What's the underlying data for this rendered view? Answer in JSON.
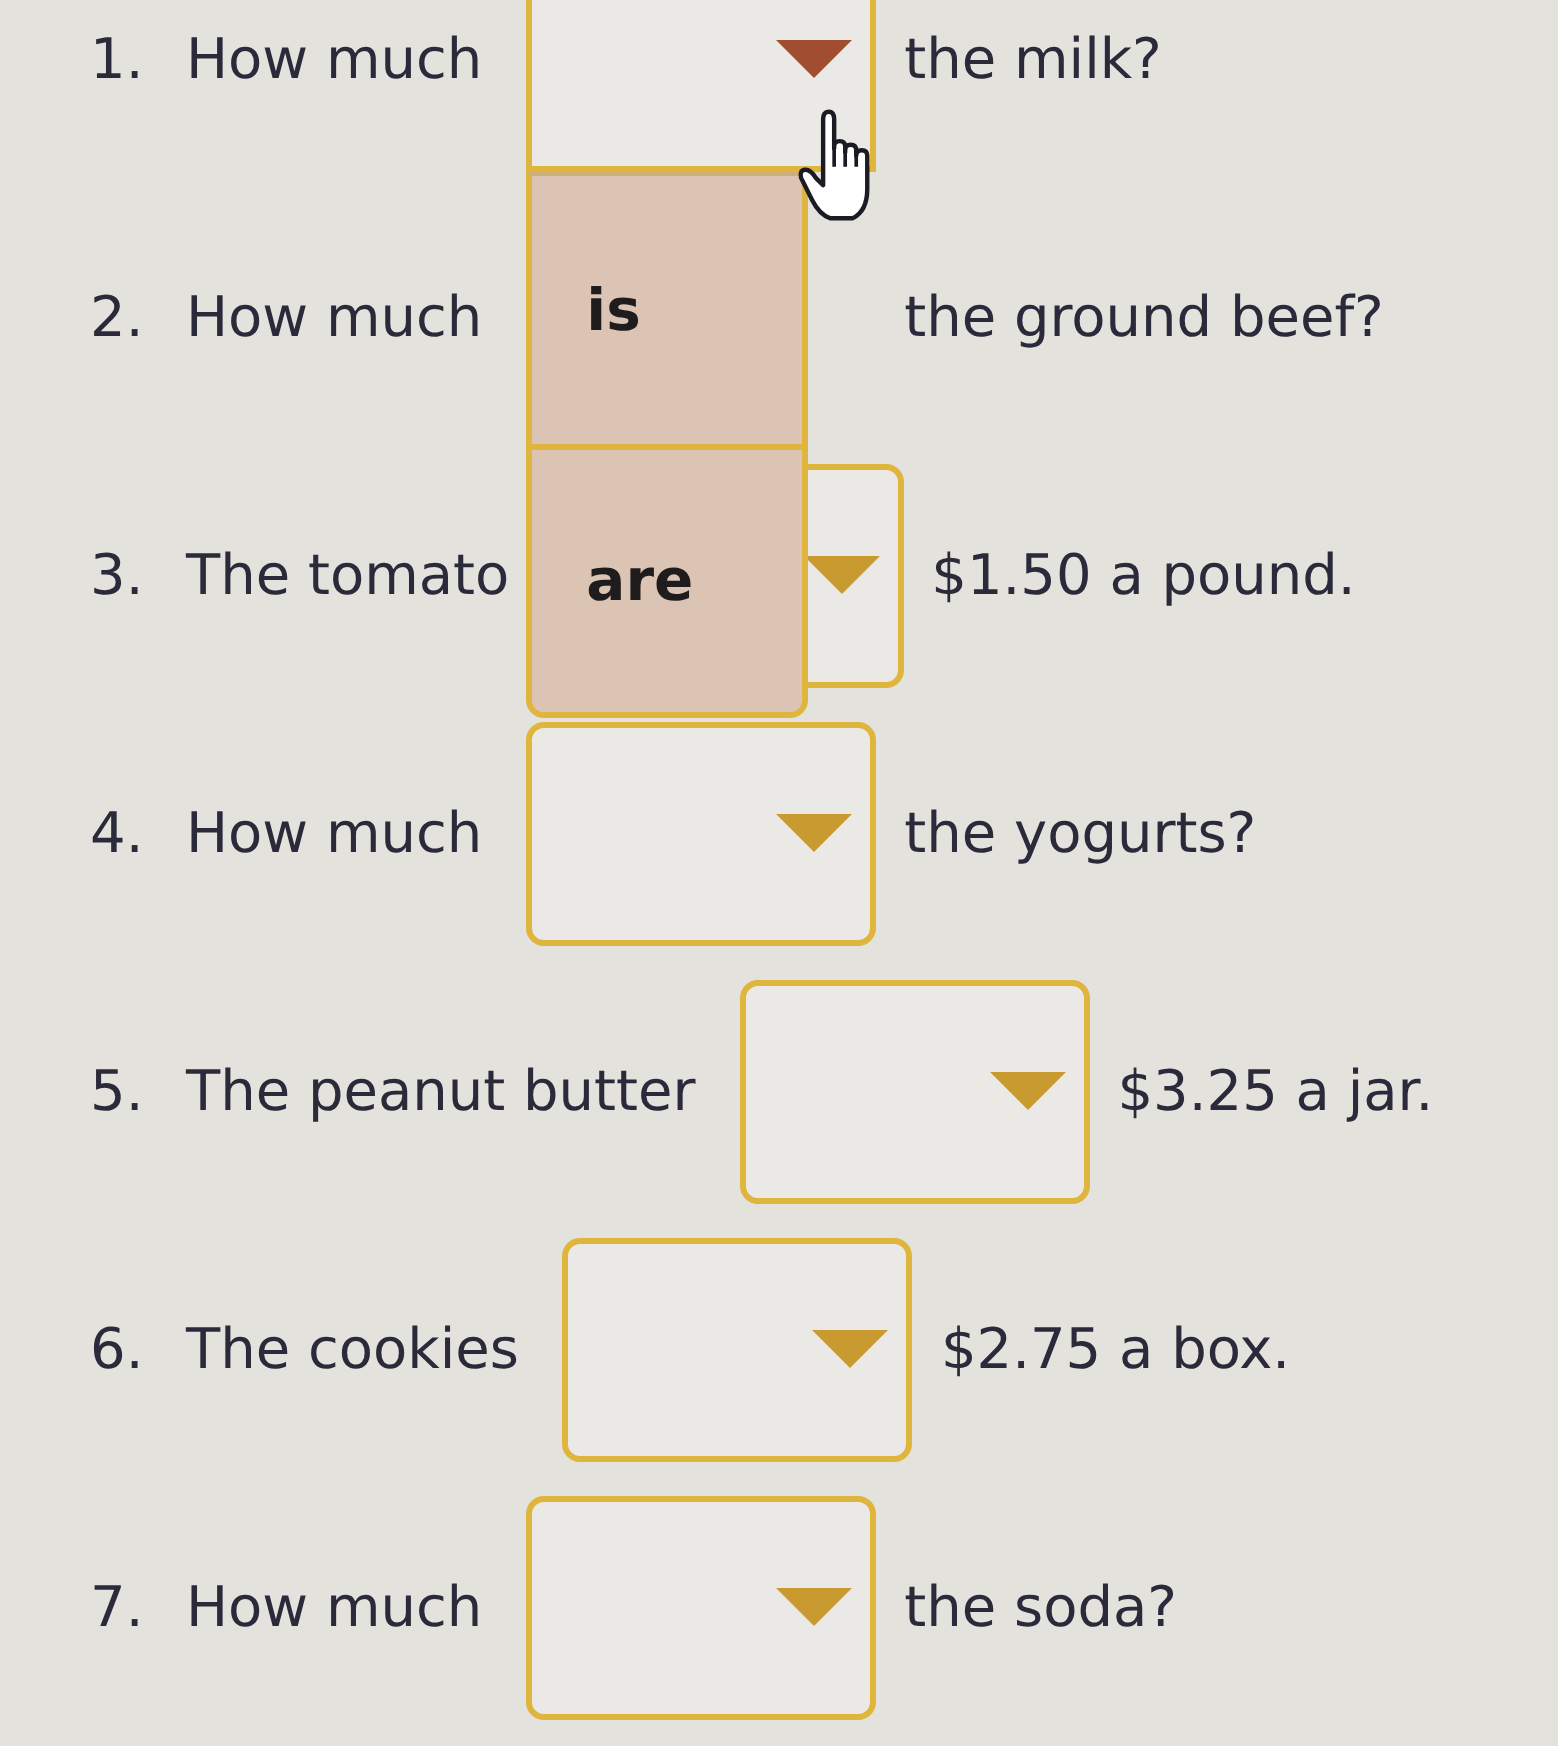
{
  "questions": [
    {
      "number": "1.",
      "prefix": "How much",
      "dropdown": {
        "expanded": true,
        "options": [
          {
            "label": "is",
            "selected": false
          },
          {
            "label": "are",
            "selected": false
          }
        ]
      },
      "suffix": "the milk?"
    },
    {
      "number": "2.",
      "prefix": "How much",
      "suffix": "the ground beef?"
    },
    {
      "number": "3.",
      "prefix": "The tomato",
      "dropdown": {
        "expanded": false
      },
      "suffix": "$1.50 a pound."
    },
    {
      "number": "4.",
      "prefix": "How much",
      "dropdown": {
        "expanded": false
      },
      "suffix": "the yogurts?"
    },
    {
      "number": "5.",
      "prefix": "The peanut butter",
      "dropdown": {
        "expanded": false
      },
      "suffix": "$3.25 a jar."
    },
    {
      "number": "6.",
      "prefix": "The cookies",
      "dropdown": {
        "expanded": false
      },
      "suffix": "$2.75 a box."
    },
    {
      "number": "7.",
      "prefix": "How much",
      "dropdown": {
        "expanded": false
      },
      "suffix": "the soda?"
    }
  ]
}
